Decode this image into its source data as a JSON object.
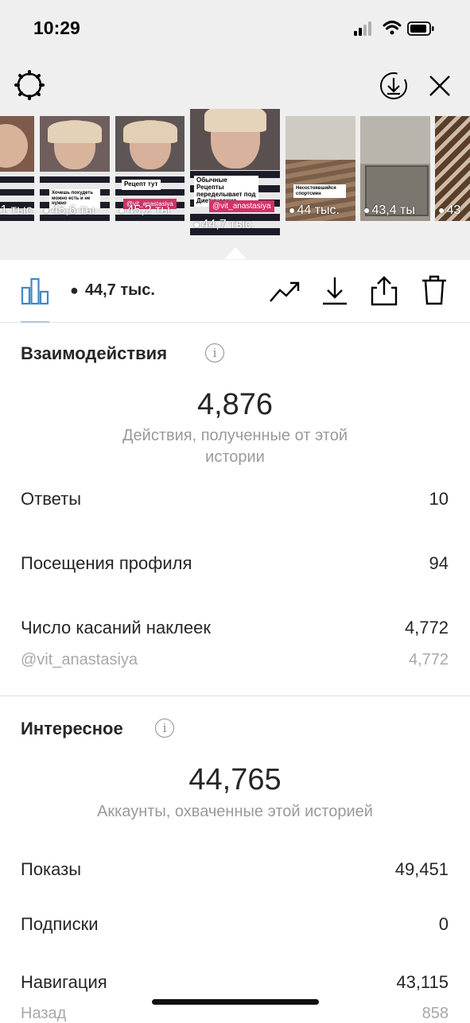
{
  "status_bar": {
    "time": "10:29"
  },
  "thumbnails": [
    {
      "views": ",1 тыс",
      "bg": "#7d5a4a"
    },
    {
      "views": "45,6 ты",
      "bg": "#6f5e5e",
      "sticker": "Хочешь похудеть можно есть и не нужно"
    },
    {
      "views": "45,2 ты",
      "bg": "#5e5656",
      "sticker": "Рецепт тут",
      "mention": "@vit_anastasiya"
    },
    {
      "views": "44,7 тыс.",
      "bg": "#5b5050",
      "sticker": "Обычные Рецепты переделывает под Диетические",
      "mention": "@vit_anastasiya",
      "selected": true
    },
    {
      "views": "44 тыс.",
      "bg": "#8a7766",
      "sticker": "Несостоявшийся спортсмен"
    },
    {
      "views": "43,4 ты",
      "bg": "#9b9488"
    },
    {
      "views": "43",
      "bg": "#6b5a4a"
    }
  ],
  "toolbar": {
    "views": "44,7 тыс."
  },
  "interactions": {
    "title": "Взаимодействия",
    "total": "4,876",
    "subtitle": "Действия, полученные от этой истории",
    "rows": [
      {
        "label": "Ответы",
        "value": "10"
      },
      {
        "label": "Посещения профиля",
        "value": "94"
      },
      {
        "label": "Число касаний наклеек",
        "value": "4,772"
      }
    ],
    "sub_row": {
      "label": "@vit_anastasiya",
      "value": "4,772"
    }
  },
  "discovery": {
    "title": "Интересное",
    "total": "44,765",
    "subtitle": "Аккаунты, охваченные этой историей",
    "rows": [
      {
        "label": "Показы",
        "value": "49,451"
      },
      {
        "label": "Подписки",
        "value": "0"
      },
      {
        "label": "Навигация",
        "value": "43,115"
      }
    ],
    "sub_row": {
      "label": "Назад",
      "value": "858"
    }
  }
}
